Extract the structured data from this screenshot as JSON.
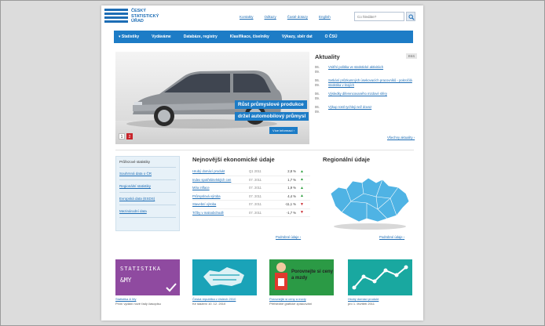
{
  "header": {
    "logo_text": "ČESKÝ STATISTICKÝ ÚŘAD",
    "top_links": [
      "Kontakty",
      "Odkazy",
      "Časté dotazy",
      "English"
    ],
    "search_placeholder": "Co hledáte?"
  },
  "nav": {
    "items": [
      "Statistiky",
      "Vydáváme",
      "Databáze, registry",
      "Klasifikace, číselníky",
      "Výkazy, sběr dat",
      "O ČSÚ"
    ]
  },
  "hero": {
    "caption_line1": "Růst průmyslové produkce",
    "caption_line2": "držel automobilový průmysl",
    "more_label": "Více informací",
    "pager": [
      "1",
      "2"
    ]
  },
  "news": {
    "title": "Aktuality",
    "rss": "RSS",
    "items": [
      {
        "date": "06. 09.",
        "text": "Vnitřní politika ve statistické aktivitách"
      },
      {
        "date": "06. 09.",
        "text": "Setkání průzkumných úsekovacích pracovníků - pokročilá statistika v krajích"
      },
      {
        "date": "06. 09.",
        "text": "Výsledky diferencovaného mzdové sféry"
      },
      {
        "date": "06. 09.",
        "text": "Výkup rostl rychleji než dovoz"
      }
    ],
    "all_label": "Všechny aktuality"
  },
  "statbox": {
    "head": "Průřezové statistiky",
    "links": [
      "Souhrnná data o ČR",
      "Regionální statistiky",
      "Evropská data (ESDS)",
      "Mezinárodní data"
    ]
  },
  "indicators": {
    "title": "Nejnovější ekonomické údaje",
    "rows": [
      {
        "name": "Hrubý domácí produkt",
        "period": "Q1 2011",
        "value": "2,8 %",
        "trend": "up"
      },
      {
        "name": "Index spotřebitelských cen",
        "period": "07. 2011",
        "value": "1,7 %",
        "trend": "up"
      },
      {
        "name": "Míra inflace",
        "period": "07. 2011",
        "value": "1,9 %",
        "trend": "up"
      },
      {
        "name": "Průmyslová výroba",
        "period": "07. 2011",
        "value": "4,4 %",
        "trend": "up"
      },
      {
        "name": "Stavební výroba",
        "period": "07. 2011",
        "value": "-11,1 %",
        "trend": "down"
      },
      {
        "name": "Tržby v maloobchodě",
        "period": "07. 2011",
        "value": "-1,7 %",
        "trend": "down"
      }
    ],
    "more_label": "Podrobné údaje"
  },
  "regional": {
    "title": "Regionální údaje",
    "more_label": "Podrobné údaje"
  },
  "promos": [
    {
      "img_text1": "STATISTIKA",
      "img_text2": "&MY",
      "caption": "Statistika & My",
      "sub": "První vydání nové řady časopisu"
    },
    {
      "caption": "Česká republika v číslech 2010",
      "sub": "Ke stažení 10. 12. 2010"
    },
    {
      "img_text": "Porovnejte si ceny a mzdy",
      "caption": "Porovnejte si ceny a mzdy",
      "sub": "Přehledné grafické zpracování"
    },
    {
      "caption": "Hrubý domácí produkt",
      "sub": "pro 1. čtvrtletí 2011"
    }
  ],
  "colors": {
    "brand_blue": "#1d7cc6",
    "map_blue": "#4fb3e4",
    "promo_purple": "#8f4aa0",
    "promo_teal": "#1aa3b8",
    "promo_green": "#2b9a45"
  }
}
